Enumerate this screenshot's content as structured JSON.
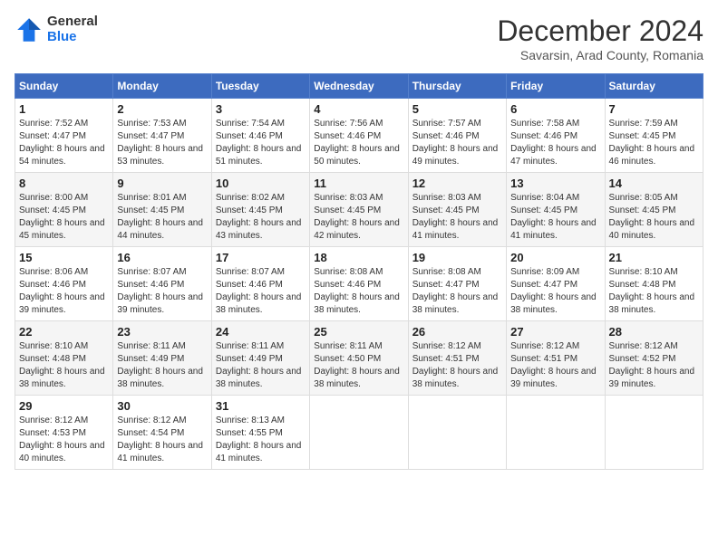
{
  "logo": {
    "general": "General",
    "blue": "Blue"
  },
  "title": "December 2024",
  "subtitle": "Savarsin, Arad County, Romania",
  "days_of_week": [
    "Sunday",
    "Monday",
    "Tuesday",
    "Wednesday",
    "Thursday",
    "Friday",
    "Saturday"
  ],
  "weeks": [
    [
      {
        "day": "1",
        "sunrise": "Sunrise: 7:52 AM",
        "sunset": "Sunset: 4:47 PM",
        "daylight": "Daylight: 8 hours and 54 minutes."
      },
      {
        "day": "2",
        "sunrise": "Sunrise: 7:53 AM",
        "sunset": "Sunset: 4:47 PM",
        "daylight": "Daylight: 8 hours and 53 minutes."
      },
      {
        "day": "3",
        "sunrise": "Sunrise: 7:54 AM",
        "sunset": "Sunset: 4:46 PM",
        "daylight": "Daylight: 8 hours and 51 minutes."
      },
      {
        "day": "4",
        "sunrise": "Sunrise: 7:56 AM",
        "sunset": "Sunset: 4:46 PM",
        "daylight": "Daylight: 8 hours and 50 minutes."
      },
      {
        "day": "5",
        "sunrise": "Sunrise: 7:57 AM",
        "sunset": "Sunset: 4:46 PM",
        "daylight": "Daylight: 8 hours and 49 minutes."
      },
      {
        "day": "6",
        "sunrise": "Sunrise: 7:58 AM",
        "sunset": "Sunset: 4:46 PM",
        "daylight": "Daylight: 8 hours and 47 minutes."
      },
      {
        "day": "7",
        "sunrise": "Sunrise: 7:59 AM",
        "sunset": "Sunset: 4:45 PM",
        "daylight": "Daylight: 8 hours and 46 minutes."
      }
    ],
    [
      {
        "day": "8",
        "sunrise": "Sunrise: 8:00 AM",
        "sunset": "Sunset: 4:45 PM",
        "daylight": "Daylight: 8 hours and 45 minutes."
      },
      {
        "day": "9",
        "sunrise": "Sunrise: 8:01 AM",
        "sunset": "Sunset: 4:45 PM",
        "daylight": "Daylight: 8 hours and 44 minutes."
      },
      {
        "day": "10",
        "sunrise": "Sunrise: 8:02 AM",
        "sunset": "Sunset: 4:45 PM",
        "daylight": "Daylight: 8 hours and 43 minutes."
      },
      {
        "day": "11",
        "sunrise": "Sunrise: 8:03 AM",
        "sunset": "Sunset: 4:45 PM",
        "daylight": "Daylight: 8 hours and 42 minutes."
      },
      {
        "day": "12",
        "sunrise": "Sunrise: 8:03 AM",
        "sunset": "Sunset: 4:45 PM",
        "daylight": "Daylight: 8 hours and 41 minutes."
      },
      {
        "day": "13",
        "sunrise": "Sunrise: 8:04 AM",
        "sunset": "Sunset: 4:45 PM",
        "daylight": "Daylight: 8 hours and 41 minutes."
      },
      {
        "day": "14",
        "sunrise": "Sunrise: 8:05 AM",
        "sunset": "Sunset: 4:45 PM",
        "daylight": "Daylight: 8 hours and 40 minutes."
      }
    ],
    [
      {
        "day": "15",
        "sunrise": "Sunrise: 8:06 AM",
        "sunset": "Sunset: 4:46 PM",
        "daylight": "Daylight: 8 hours and 39 minutes."
      },
      {
        "day": "16",
        "sunrise": "Sunrise: 8:07 AM",
        "sunset": "Sunset: 4:46 PM",
        "daylight": "Daylight: 8 hours and 39 minutes."
      },
      {
        "day": "17",
        "sunrise": "Sunrise: 8:07 AM",
        "sunset": "Sunset: 4:46 PM",
        "daylight": "Daylight: 8 hours and 38 minutes."
      },
      {
        "day": "18",
        "sunrise": "Sunrise: 8:08 AM",
        "sunset": "Sunset: 4:46 PM",
        "daylight": "Daylight: 8 hours and 38 minutes."
      },
      {
        "day": "19",
        "sunrise": "Sunrise: 8:08 AM",
        "sunset": "Sunset: 4:47 PM",
        "daylight": "Daylight: 8 hours and 38 minutes."
      },
      {
        "day": "20",
        "sunrise": "Sunrise: 8:09 AM",
        "sunset": "Sunset: 4:47 PM",
        "daylight": "Daylight: 8 hours and 38 minutes."
      },
      {
        "day": "21",
        "sunrise": "Sunrise: 8:10 AM",
        "sunset": "Sunset: 4:48 PM",
        "daylight": "Daylight: 8 hours and 38 minutes."
      }
    ],
    [
      {
        "day": "22",
        "sunrise": "Sunrise: 8:10 AM",
        "sunset": "Sunset: 4:48 PM",
        "daylight": "Daylight: 8 hours and 38 minutes."
      },
      {
        "day": "23",
        "sunrise": "Sunrise: 8:11 AM",
        "sunset": "Sunset: 4:49 PM",
        "daylight": "Daylight: 8 hours and 38 minutes."
      },
      {
        "day": "24",
        "sunrise": "Sunrise: 8:11 AM",
        "sunset": "Sunset: 4:49 PM",
        "daylight": "Daylight: 8 hours and 38 minutes."
      },
      {
        "day": "25",
        "sunrise": "Sunrise: 8:11 AM",
        "sunset": "Sunset: 4:50 PM",
        "daylight": "Daylight: 8 hours and 38 minutes."
      },
      {
        "day": "26",
        "sunrise": "Sunrise: 8:12 AM",
        "sunset": "Sunset: 4:51 PM",
        "daylight": "Daylight: 8 hours and 38 minutes."
      },
      {
        "day": "27",
        "sunrise": "Sunrise: 8:12 AM",
        "sunset": "Sunset: 4:51 PM",
        "daylight": "Daylight: 8 hours and 39 minutes."
      },
      {
        "day": "28",
        "sunrise": "Sunrise: 8:12 AM",
        "sunset": "Sunset: 4:52 PM",
        "daylight": "Daylight: 8 hours and 39 minutes."
      }
    ],
    [
      {
        "day": "29",
        "sunrise": "Sunrise: 8:12 AM",
        "sunset": "Sunset: 4:53 PM",
        "daylight": "Daylight: 8 hours and 40 minutes."
      },
      {
        "day": "30",
        "sunrise": "Sunrise: 8:12 AM",
        "sunset": "Sunset: 4:54 PM",
        "daylight": "Daylight: 8 hours and 41 minutes."
      },
      {
        "day": "31",
        "sunrise": "Sunrise: 8:13 AM",
        "sunset": "Sunset: 4:55 PM",
        "daylight": "Daylight: 8 hours and 41 minutes."
      },
      null,
      null,
      null,
      null
    ]
  ]
}
